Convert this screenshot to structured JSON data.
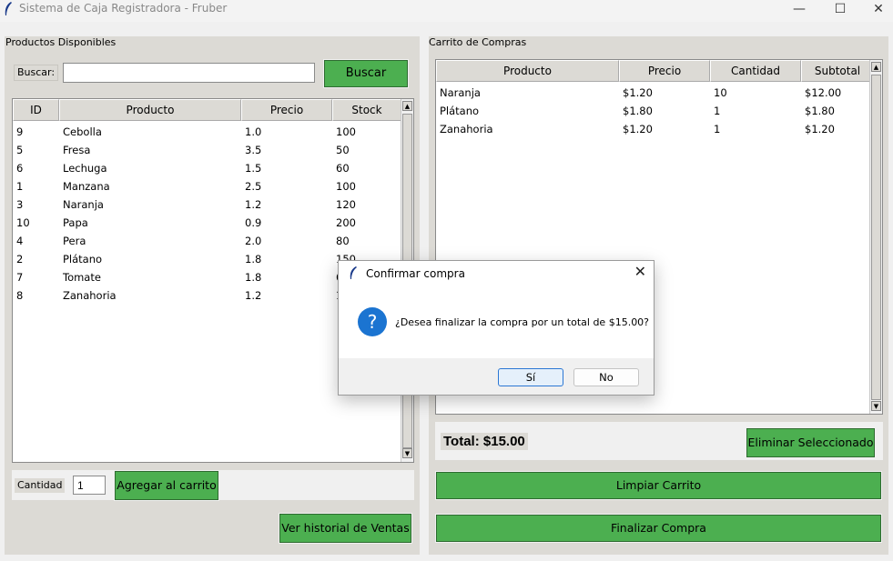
{
  "window": {
    "title": "Sistema de Caja Registradora - Fruber",
    "min_icon": "minimize-icon",
    "max_icon": "maximize-icon",
    "close_icon": "close-icon",
    "app_icon": "feather-icon"
  },
  "left": {
    "label": "Productos Disponibles",
    "search_label": "Buscar:",
    "search_value": "",
    "search_button": "Buscar",
    "columns": [
      "ID",
      "Producto",
      "Precio",
      "Stock"
    ],
    "rows": [
      [
        "9",
        "Cebolla",
        "1.0",
        "100"
      ],
      [
        "5",
        "Fresa",
        "3.5",
        "50"
      ],
      [
        "6",
        "Lechuga",
        "1.5",
        "60"
      ],
      [
        "1",
        "Manzana",
        "2.5",
        "100"
      ],
      [
        "3",
        "Naranja",
        "1.2",
        "120"
      ],
      [
        "10",
        "Papa",
        "0.9",
        "200"
      ],
      [
        "4",
        "Pera",
        "2.0",
        "80"
      ],
      [
        "2",
        "Plátano",
        "1.8",
        "150"
      ],
      [
        "7",
        "Tomate",
        "1.8",
        "6"
      ],
      [
        "8",
        "Zanahoria",
        "1.2",
        "1"
      ]
    ],
    "qty_label": "Cantidad",
    "qty_value": "1",
    "add_button": "Agregar al carrito",
    "history_button": "Ver historial de Ventas"
  },
  "right": {
    "label": "Carrito de Compras",
    "columns": [
      "Producto",
      "Precio",
      "Cantidad",
      "Subtotal"
    ],
    "rows": [
      [
        "Naranja",
        "$1.20",
        "10",
        "$12.00"
      ],
      [
        "Plátano",
        "$1.80",
        "1",
        "$1.80"
      ],
      [
        "Zanahoria",
        "$1.20",
        "1",
        "$1.20"
      ]
    ],
    "total": "Total: $15.00",
    "remove_button": "Eliminar Seleccionado",
    "clear_button": "Limpiar Carrito",
    "checkout_button": "Finalizar Compra"
  },
  "dialog": {
    "title": "Confirmar compra",
    "message": "¿Desea finalizar la compra por un total de $15.00?",
    "yes": "Sí",
    "no": "No",
    "icon": "question-icon"
  },
  "colors": {
    "green": "#4caf50",
    "panel": "#dcdad5",
    "accent": "#1b74d1"
  }
}
